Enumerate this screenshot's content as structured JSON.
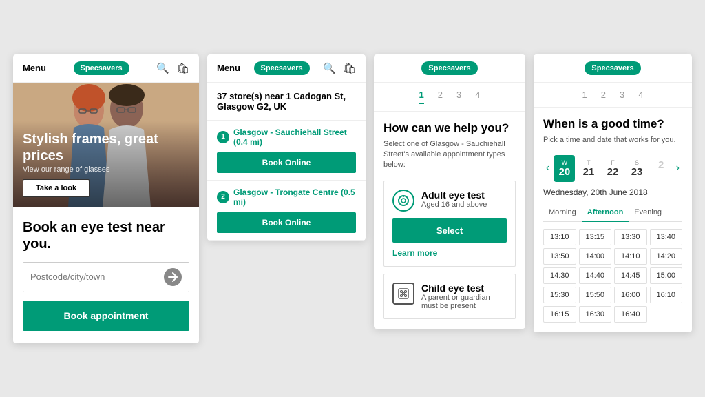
{
  "screen1": {
    "nav": {
      "menu": "Menu",
      "logo": "Specsavers",
      "search_icon": "🔍",
      "cart_icon": "🛍"
    },
    "hero": {
      "title": "Stylish frames, great prices",
      "subtitle": "View our range of glasses",
      "cta": "Take a look"
    },
    "body": {
      "title": "Book an eye test near you.",
      "input_placeholder": "Postcode/city/town",
      "book_btn": "Book appointment"
    }
  },
  "screen2": {
    "nav": {
      "menu": "Menu",
      "logo": "Specsavers"
    },
    "store_count": "37 store(s) near 1 Cadogan St, Glasgow G2, UK",
    "stores": [
      {
        "num": "1",
        "name": "Glasgow - Sauchiehall Street (0.4 mi)",
        "book_btn": "Book Online"
      },
      {
        "num": "2",
        "name": "Glasgow - Trongate Centre (0.5 mi)",
        "book_btn": "Book Online"
      }
    ]
  },
  "screen3": {
    "nav": {
      "logo": "Specsavers"
    },
    "steps": [
      "1",
      "2",
      "3",
      "4"
    ],
    "active_step": "1",
    "heading": "How can we help you?",
    "subtext": "Select one of Glasgow - Sauchiehall Street's available appointment types below:",
    "adult": {
      "title": "Adult eye test",
      "subtitle": "Aged 16 and above",
      "select_btn": "Select",
      "learn_more": "Learn more"
    },
    "child": {
      "title": "Child eye test",
      "subtitle": "A parent or guardian must be present"
    }
  },
  "screen4": {
    "nav": {
      "logo": "Specsavers"
    },
    "steps": [
      "1",
      "2",
      "3",
      "4"
    ],
    "heading": "When is a good time?",
    "subtext": "Pick a time and date that works for you.",
    "calendar": {
      "days": [
        {
          "dow": "W",
          "date": "20",
          "active": true
        },
        {
          "dow": "T",
          "date": "21",
          "active": false
        },
        {
          "dow": "F",
          "date": "22",
          "active": false
        },
        {
          "dow": "S",
          "date": "23",
          "active": false
        },
        {
          "dow": "",
          "date": "2",
          "active": false
        }
      ],
      "date_label": "Wednesday, 20th June 2018"
    },
    "time_tabs": [
      "Morning",
      "Afternoon",
      "Evening"
    ],
    "active_tab": "Afternoon",
    "time_slots": [
      "13:10",
      "13:15",
      "13:30",
      "13:40",
      "13:50",
      "14:00",
      "14:10",
      "14:20",
      "14:30",
      "14:40",
      "14:45",
      "15:00",
      "15:30",
      "15:50",
      "16:00",
      "16:10",
      "16:15",
      "16:30",
      "16:40",
      ""
    ]
  }
}
